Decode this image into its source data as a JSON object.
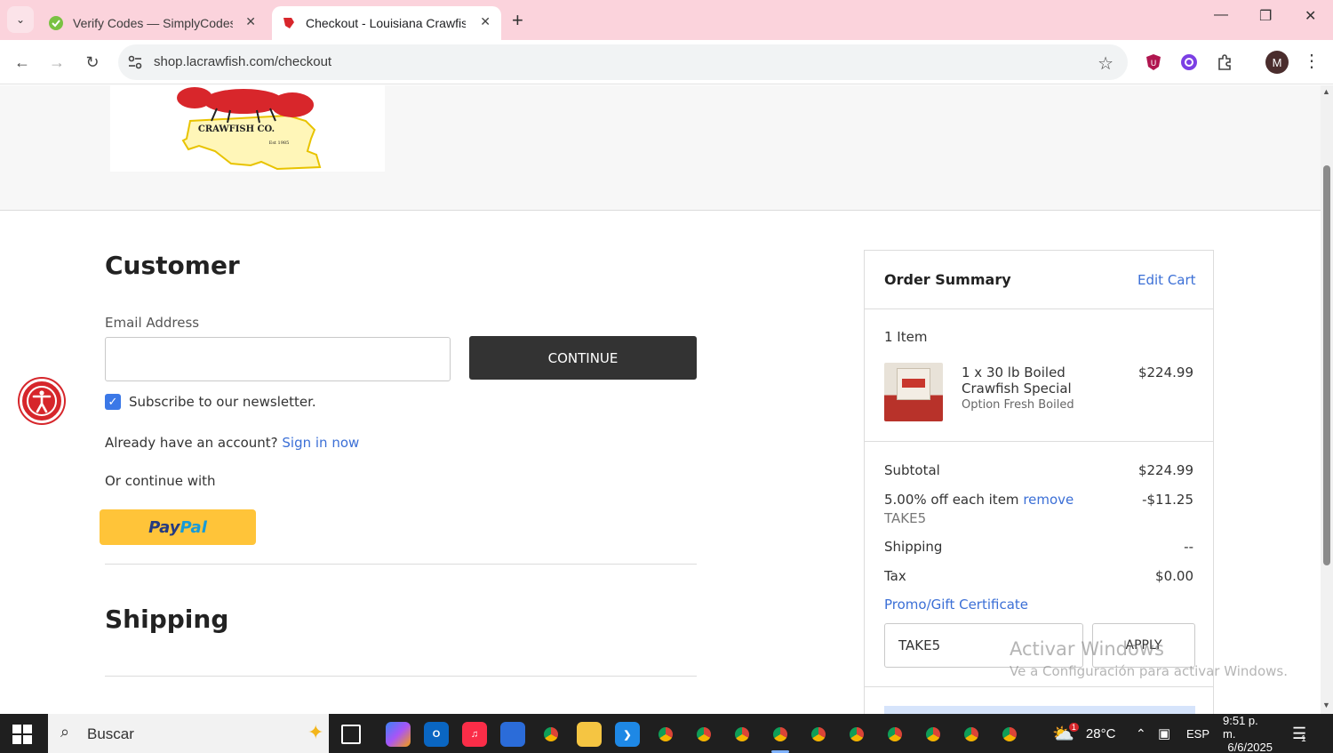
{
  "browser": {
    "tabs": [
      {
        "title": "Verify Codes — SimplyCodes",
        "active": false
      },
      {
        "title": "Checkout - Louisiana Crawfish Co",
        "active": true
      }
    ],
    "url": "shop.lacrawfish.com/checkout",
    "profile_initial": "M"
  },
  "logo": {
    "brand_text": "CRAWFISH CO.",
    "est_text": "Est 1985"
  },
  "customer": {
    "heading": "Customer",
    "email_label": "Email Address",
    "email_value": "",
    "continue_label": "CONTINUE",
    "newsletter_label": "Subscribe to our newsletter.",
    "newsletter_checked": true,
    "account_prompt": "Already have an account?",
    "sign_in_label": "Sign in now",
    "or_continue": "Or continue with",
    "paypal_pay": "Pay",
    "paypal_pal": "Pal"
  },
  "shipping": {
    "heading": "Shipping"
  },
  "order_summary": {
    "title": "Order Summary",
    "edit_cart_label": "Edit Cart",
    "item_count": "1 Item",
    "item": {
      "name": "1 x 30 lb Boiled Crawfish Special",
      "option": "Option Fresh Boiled",
      "price": "$224.99"
    },
    "subtotal_label": "Subtotal",
    "subtotal_value": "$224.99",
    "discount_label": "5.00% off each item",
    "discount_remove": "remove",
    "discount_code": "TAKE5",
    "discount_value": "-$11.25",
    "shipping_label": "Shipping",
    "shipping_value": "--",
    "tax_label": "Tax",
    "tax_value": "$0.00",
    "promo_label": "Promo/Gift Certificate",
    "promo_value": "TAKE5",
    "apply_label": "APPLY"
  },
  "watermark": {
    "line1": "Activar Windows",
    "line2": "Ve a Configuración para activar Windows."
  },
  "taskbar": {
    "search_placeholder": "Buscar",
    "weather": "28°C",
    "language": "ESP",
    "time": "9:51 p. m.",
    "date": "6/6/2025",
    "notification_count": "1",
    "weather_badge": "1"
  },
  "colors": {
    "tabstrip": "#fbd3dc",
    "link": "#3b6fd6",
    "continue_bg": "#333333",
    "paypal_bg": "#ffc439",
    "accessibility": "#d6262b"
  }
}
